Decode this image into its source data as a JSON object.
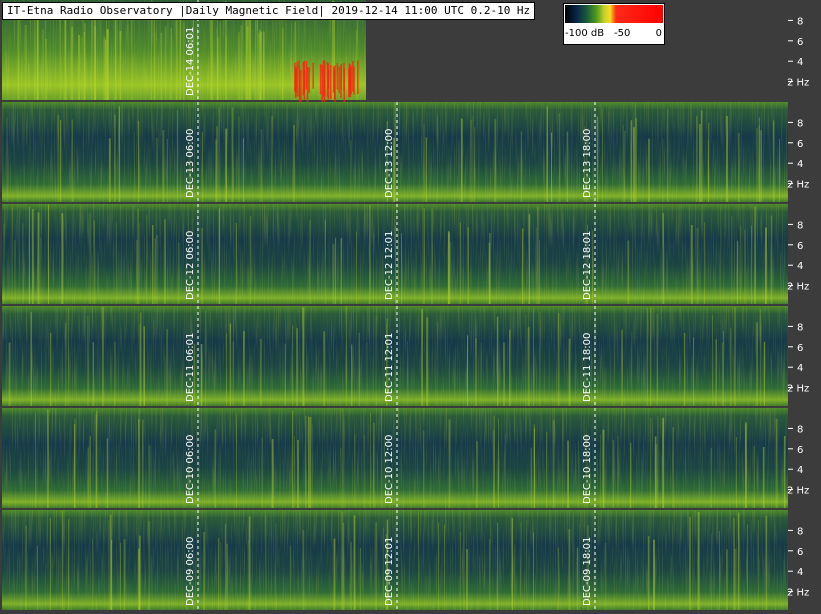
{
  "title": "IT-Etna Radio Observatory |Daily Magnetic Field| 2019-12-14 11:00 UTC 0.2-10 Hz",
  "colorbar": {
    "labels": [
      "-100 dB",
      "-50",
      "0"
    ],
    "colors": [
      "#000000",
      "#0a2b4c",
      "#2e7a32",
      "#d6d22a",
      "#ff0000"
    ]
  },
  "chart_data": {
    "type": "heatmap",
    "title": "IT-Etna Radio Observatory |Daily Magnetic Field| 2019-12-14 11:00 UTC 0.2-10 Hz",
    "xlabel": "",
    "ylabel": "",
    "yunit": "Hz",
    "ylim": [
      0.2,
      10
    ],
    "yticks": [
      2,
      4,
      6,
      8
    ],
    "color_scale": {
      "unit": "dB",
      "range": [
        -100,
        0
      ],
      "ticks": [
        -100,
        -50,
        0
      ]
    },
    "rows": [
      {
        "day": "2019-12-14",
        "markers": [
          "DEC-14 06:01"
        ],
        "partial": true
      },
      {
        "day": "2019-12-13",
        "markers": [
          "DEC-13 06:00",
          "DEC-13 12:00",
          "DEC-13 18:00"
        ]
      },
      {
        "day": "2019-12-12",
        "markers": [
          "DEC-12 06:00",
          "DEC-12 12:01",
          "DEC-12 18:01"
        ]
      },
      {
        "day": "2019-12-11",
        "markers": [
          "DEC-11 06:01",
          "DEC-11 12:01",
          "DEC-11 18:00"
        ]
      },
      {
        "day": "2019-12-10",
        "markers": [
          "DEC-10 06:00",
          "DEC-10 12:00",
          "DEC-10 18:00"
        ]
      },
      {
        "day": "2019-12-09",
        "markers": [
          "DEC-09 06:00",
          "DEC-09 12:01",
          "DEC-09 18:01"
        ]
      }
    ]
  }
}
